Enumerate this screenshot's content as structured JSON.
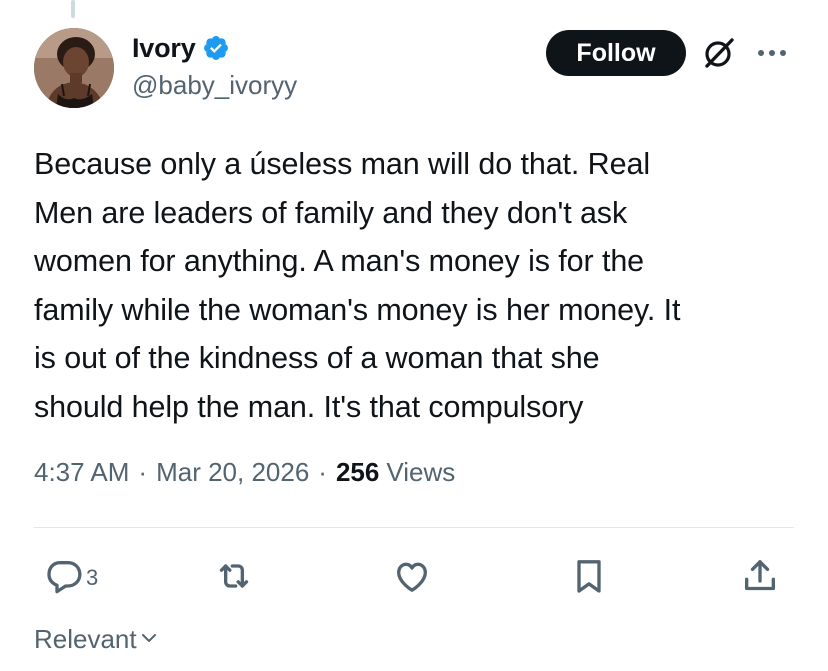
{
  "author": {
    "display_name": "Ivory",
    "handle": "@baby_ivoryy",
    "verified": true,
    "verified_color": "#1d9bf0"
  },
  "follow_label": "Follow",
  "icons": {
    "grok": "grok-icon",
    "more": "more-icon",
    "reply": "reply-icon",
    "repost": "repost-icon",
    "like": "heart-icon",
    "bookmark": "bookmark-icon",
    "share": "share-icon"
  },
  "tweet": {
    "lines": [
      "Because only a úseless man will do that. Real",
      "Men are leaders of family and they don't ask",
      "women for anything. A man's money is for the",
      "family while the woman's money is her money. It",
      "is out of the kindness of a woman that she",
      "should help the man. It's that compulsory"
    ]
  },
  "meta": {
    "time": "4:37 AM",
    "separator": "·",
    "date": "Mar 20, 2026",
    "views_count": "256",
    "views_label": "Views"
  },
  "actions": {
    "reply_count": "3"
  },
  "sort": {
    "label": "Relevant"
  },
  "colors": {
    "text": "#0f1419",
    "secondary": "#536471",
    "button_bg": "#0f1419",
    "divider": "#e1e6e9"
  }
}
